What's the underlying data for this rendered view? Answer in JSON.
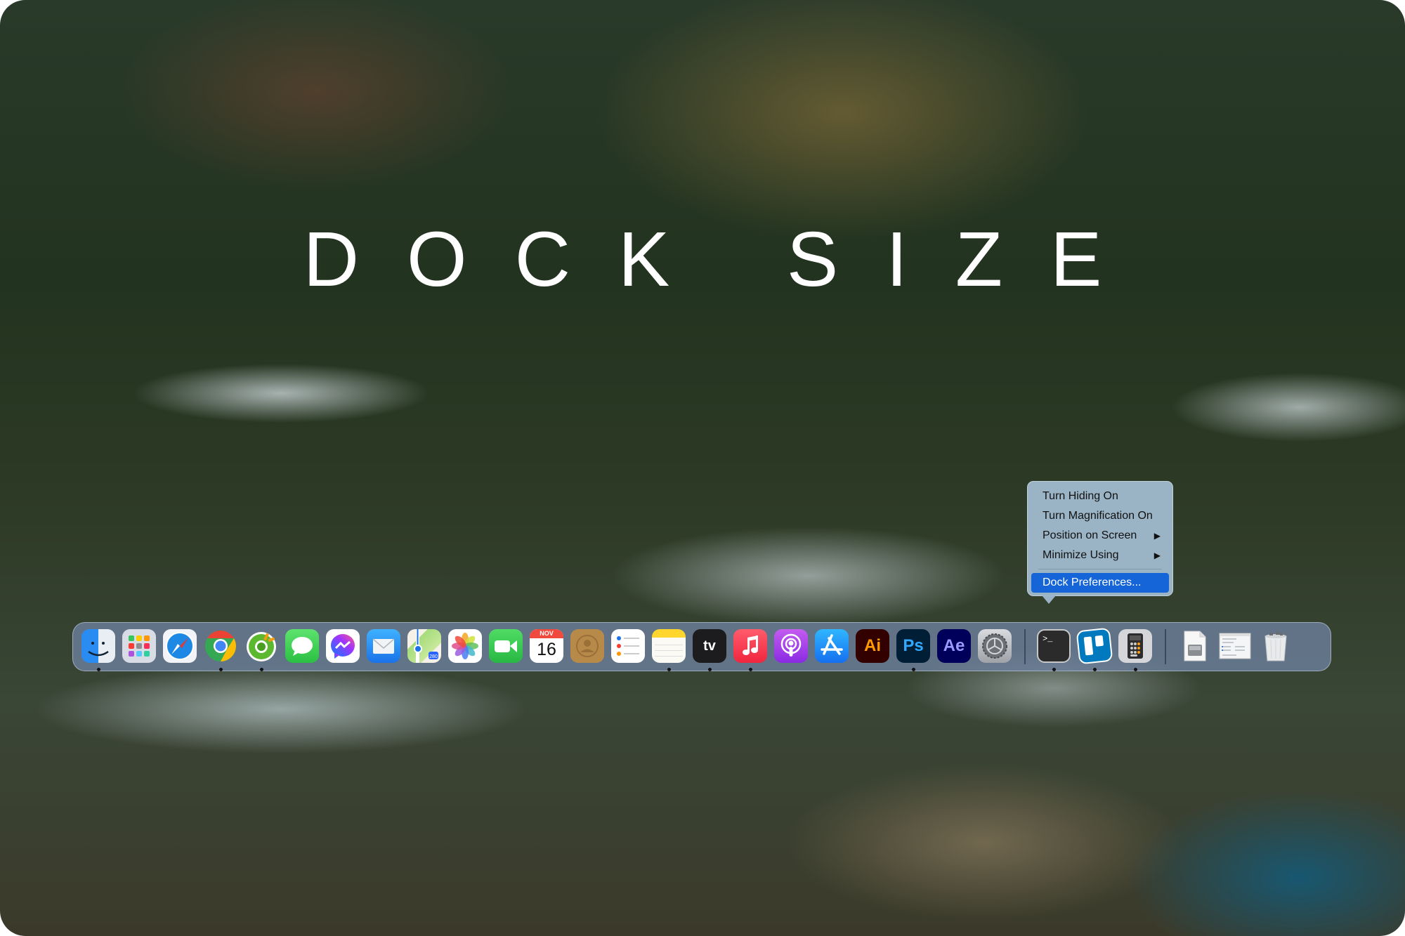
{
  "title": "DOCK SIZE",
  "context_menu": {
    "items": [
      {
        "label": "Turn Hiding On",
        "submenu": false
      },
      {
        "label": "Turn Magnification On",
        "submenu": false
      },
      {
        "label": "Position on Screen",
        "submenu": true
      },
      {
        "label": "Minimize Using",
        "submenu": true
      }
    ],
    "selected_item": {
      "label": "Dock Preferences..."
    },
    "submenu_arrow": "▶"
  },
  "dock": {
    "apps": [
      {
        "name": "Finder",
        "icon": "finder-icon",
        "running": true
      },
      {
        "name": "Launchpad",
        "icon": "launchpad-icon",
        "running": false
      },
      {
        "name": "Safari",
        "icon": "safari-icon",
        "running": false
      },
      {
        "name": "Google Chrome",
        "icon": "chrome-icon",
        "running": true
      },
      {
        "name": "Coc Coc",
        "icon": "coccoc-icon",
        "running": true
      },
      {
        "name": "Messages",
        "icon": "messages-icon",
        "running": false
      },
      {
        "name": "Messenger",
        "icon": "messenger-icon",
        "running": false
      },
      {
        "name": "Mail",
        "icon": "mail-icon",
        "running": false
      },
      {
        "name": "Maps",
        "icon": "maps-icon",
        "running": false,
        "badge": "280"
      },
      {
        "name": "Photos",
        "icon": "photos-icon",
        "running": false
      },
      {
        "name": "FaceTime",
        "icon": "facetime-icon",
        "running": false
      },
      {
        "name": "Calendar",
        "icon": "calendar-icon",
        "running": false,
        "month": "NOV",
        "day": "16"
      },
      {
        "name": "Contacts",
        "icon": "contacts-icon",
        "running": false
      },
      {
        "name": "Reminders",
        "icon": "reminders-icon",
        "running": false
      },
      {
        "name": "Notes",
        "icon": "notes-icon",
        "running": true
      },
      {
        "name": "Apple TV",
        "icon": "appletv-icon",
        "running": true,
        "label": "tv"
      },
      {
        "name": "Music",
        "icon": "music-icon",
        "running": true
      },
      {
        "name": "Podcasts",
        "icon": "podcasts-icon",
        "running": false
      },
      {
        "name": "App Store",
        "icon": "appstore-icon",
        "running": false
      },
      {
        "name": "Adobe Illustrator",
        "icon": "illustrator-icon",
        "running": false,
        "label": "Ai"
      },
      {
        "name": "Adobe Photoshop",
        "icon": "photoshop-icon",
        "running": true,
        "label": "Ps"
      },
      {
        "name": "Adobe After Effects",
        "icon": "aftereffects-icon",
        "running": false,
        "label": "Ae"
      },
      {
        "name": "System Preferences",
        "icon": "system-preferences-icon",
        "running": false
      }
    ],
    "recent_apps": [
      {
        "name": "Terminal",
        "icon": "terminal-icon",
        "running": true,
        "label": ">_"
      },
      {
        "name": "Trello",
        "icon": "trello-icon",
        "running": true
      },
      {
        "name": "Calculator",
        "icon": "calculator-icon",
        "running": true
      }
    ],
    "stacks": [
      {
        "name": "Disk Image",
        "icon": "disk-image-icon"
      },
      {
        "name": "Window Preview",
        "icon": "window-preview-icon"
      },
      {
        "name": "Trash",
        "icon": "trash-icon"
      }
    ]
  }
}
